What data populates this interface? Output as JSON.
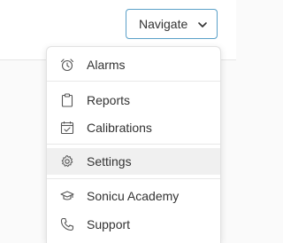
{
  "header": {
    "navigate_label": "Navigate",
    "navigate_icon": "chevron-down-icon"
  },
  "menu": {
    "items": [
      {
        "label": "Alarms",
        "icon": "alarm-clock-icon"
      },
      {
        "label": "Reports",
        "icon": "clipboard-icon"
      },
      {
        "label": "Calibrations",
        "icon": "calendar-check-icon"
      },
      {
        "label": "Settings",
        "icon": "gear-icon",
        "active": true
      },
      {
        "label": "Sonicu Academy",
        "icon": "graduation-cap-icon"
      },
      {
        "label": "Support",
        "icon": "phone-icon"
      }
    ]
  },
  "colors": {
    "accent_border": "#5aa0c8",
    "active_bg": "#f0f0f0",
    "text": "#333333"
  }
}
